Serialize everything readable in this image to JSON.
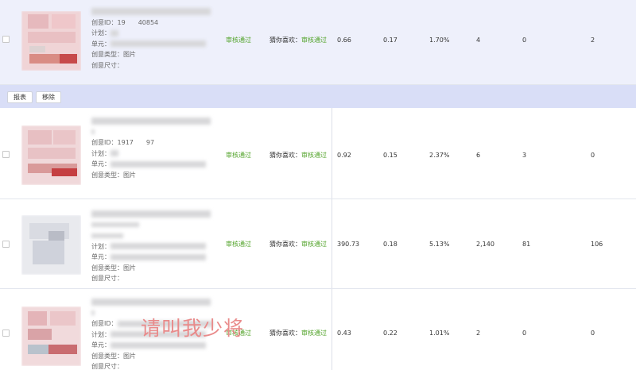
{
  "actions": {
    "report_label": "报表",
    "remove_label": "移除"
  },
  "rows": [
    {
      "creative_id": "创意ID：19　　40854",
      "plan": "计划：",
      "unit": "单元：",
      "creative_type": "创意类型：图片",
      "creative_size": "创意尺寸：",
      "status": "审核通过",
      "channel_prefix": "猜你喜欢：",
      "channel_status": "审核通过",
      "metrics": [
        "0.66",
        "0.17",
        "1.70%",
        "4",
        "0",
        "2"
      ]
    },
    {
      "creative_id": "创意ID：1917　　97",
      "plan": "计划：",
      "unit": "单元：",
      "creative_type": "创意类型：图片",
      "creative_size": "",
      "status": "审核通过",
      "channel_prefix": "猜你喜欢：",
      "channel_status": "审核通过",
      "metrics": [
        "0.92",
        "0.15",
        "2.37%",
        "6",
        "3",
        "0"
      ]
    },
    {
      "creative_id": "",
      "plan": "计划：",
      "unit": "单元：",
      "creative_type": "创意类型：图片",
      "creative_size": "创意尺寸：",
      "status": "审核通过",
      "channel_prefix": "猜你喜欢：",
      "channel_status": "审核通过",
      "metrics": [
        "390.73",
        "0.18",
        "5.13%",
        "2,140",
        "81",
        "106"
      ]
    },
    {
      "creative_id": "创意ID：",
      "plan": "计划：",
      "unit": "单元：",
      "creative_type": "创意类型：图片",
      "creative_size": "创意尺寸：",
      "status": "审核通过",
      "channel_prefix": "猜你喜欢：",
      "channel_status": "审核通过",
      "metrics": [
        "0.43",
        "0.22",
        "1.01%",
        "2",
        "0",
        "0"
      ]
    }
  ],
  "watermark": "请叫我少将"
}
